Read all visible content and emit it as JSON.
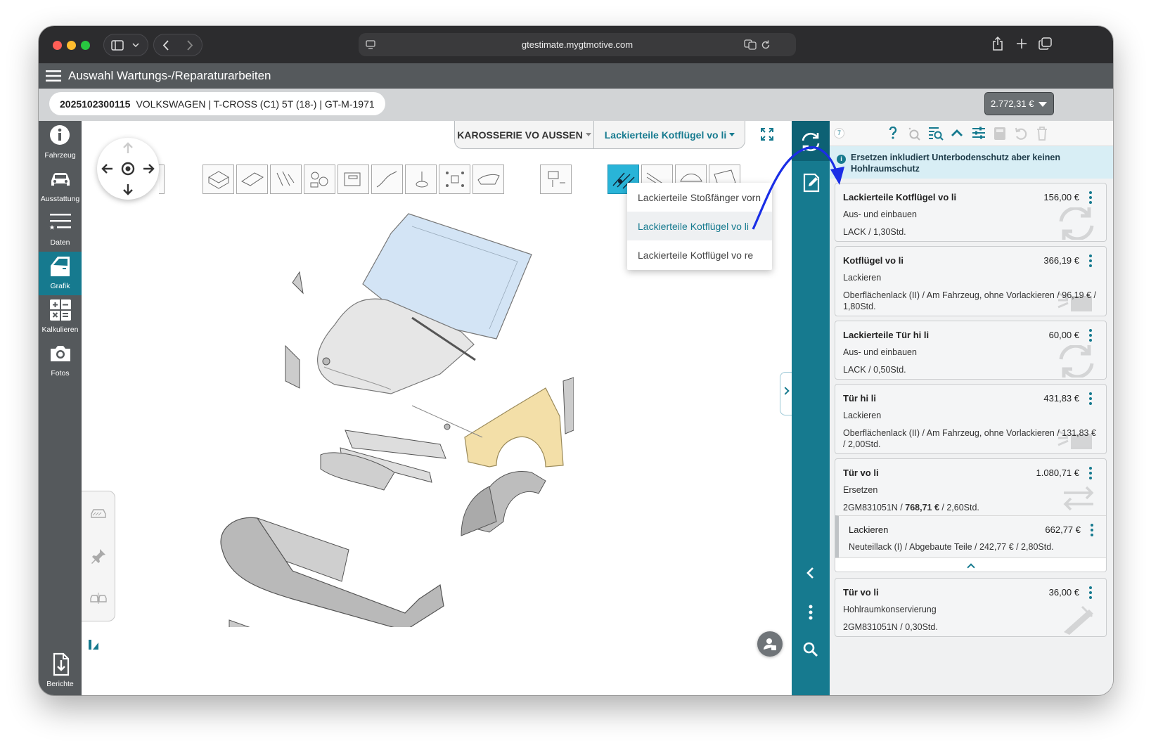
{
  "browser": {
    "url": "gtestimate.mygtmotive.com"
  },
  "header": {
    "title": "Auswahl Wartungs-/Reparaturarbeiten"
  },
  "vehicle": {
    "id": "2025102300115",
    "description": "VOLKSWAGEN | T-CROSS (C1) 5T (18-) | GT-M-1971",
    "total": "2.772,31 €"
  },
  "sidebar": {
    "items": [
      {
        "label": "Fahrzeug",
        "icon": "info-icon"
      },
      {
        "label": "Ausstattung",
        "icon": "car-icon"
      },
      {
        "label": "Daten",
        "icon": "list-icon"
      },
      {
        "label": "Grafik",
        "icon": "door-icon",
        "active": true
      },
      {
        "label": "Kalkulieren",
        "icon": "calculator-icon"
      },
      {
        "label": "Fotos",
        "icon": "camera-icon"
      }
    ],
    "bottom": {
      "label": "Berichte",
      "icon": "report-download-icon"
    }
  },
  "graphic": {
    "category": "KAROSSERIE VO AUSSEN",
    "subcategory": "Lackierteile Kotflügel vo li",
    "dropdown": [
      {
        "label": "Lackierteile Stoßfänger vorn",
        "selected": false
      },
      {
        "label": "Lackierteile Kotflügel vo li",
        "selected": true
      },
      {
        "label": "Lackierteile Kotflügel vo re",
        "selected": false
      }
    ]
  },
  "estimate": {
    "count": "7",
    "banner": "Ersetzen inkludiert Unterbodenschutz aber keinen Hohlraumschutz",
    "items": [
      {
        "title": "Lackierteile Kotflügel vo li",
        "price": "156,00 €",
        "operation": "Aus- und einbauen",
        "detail": "LACK / 1,30Std.",
        "icon": "refresh-icon"
      },
      {
        "title": "Kotflügel vo li",
        "price": "366,19 €",
        "operation": "Lackieren",
        "detail": "Oberflächenlack (II) / Am Fahrzeug, ohne Vorlackieren / 96,19 € / 1,80Std.",
        "icon": "spray-icon"
      },
      {
        "title": "Lackierteile Tür hi li",
        "price": "60,00 €",
        "operation": "Aus- und einbauen",
        "detail": "LACK / 0,50Std.",
        "icon": "refresh-icon"
      },
      {
        "title": "Tür hi li",
        "price": "431,83 €",
        "operation": "Lackieren",
        "detail": "Oberflächenlack (II) / Am Fahrzeug, ohne Vorlackieren / 131,83 € / 2,00Std.",
        "icon": "spray-icon"
      },
      {
        "title": "Tür vo li",
        "price": "1.080,71 €",
        "operation": "Ersetzen",
        "detail_pre": "2GM831051N / ",
        "detail_bold": "768,71 €",
        "detail_post": " / 2,60Std.",
        "icon": "swap-icon",
        "sub": {
          "title": "Lackieren",
          "price": "662,77 €",
          "detail": "Neuteillack (I) / Abgebaute Teile / 242,77 € / 2,80Std."
        }
      },
      {
        "title": "Tür vo li",
        "price": "36,00 €",
        "operation": "Hohlraumkonservierung",
        "detail": "2GM831051N / 0,30Std.",
        "icon": "nozzle-icon"
      }
    ]
  },
  "colors": {
    "accent": "#167a8f",
    "header": "#55595c",
    "highlight_part": "#f3dfa8",
    "windshield": "#d3e4f5",
    "annotation_arrow": "#1a2ee6"
  }
}
